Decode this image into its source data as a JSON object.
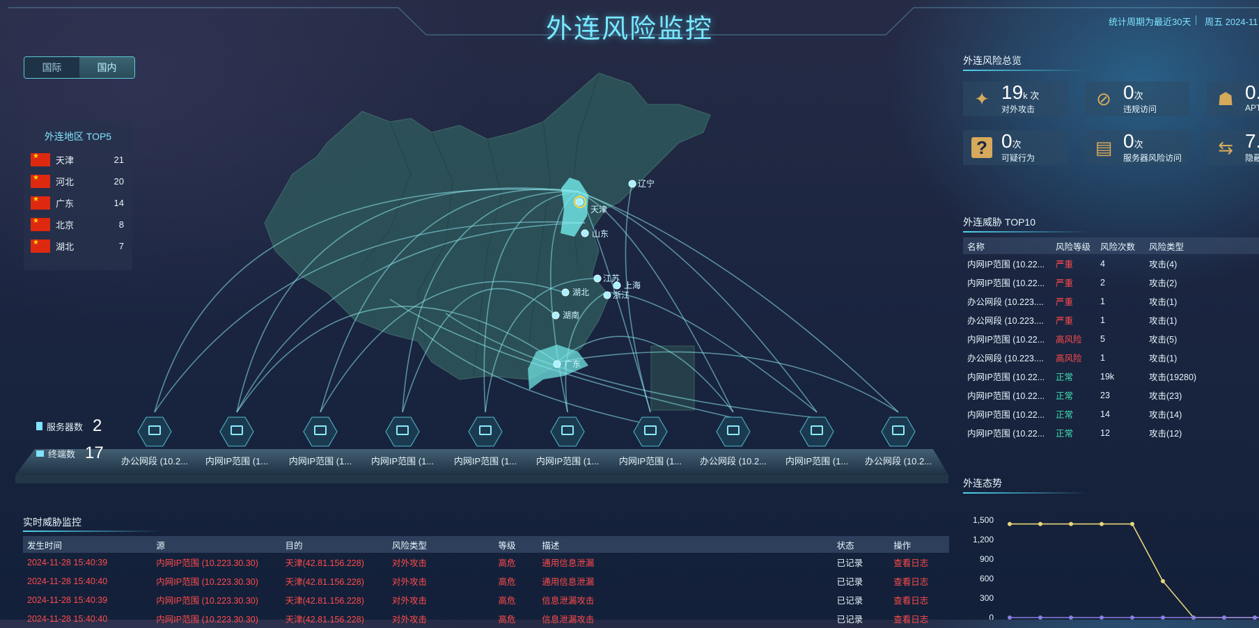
{
  "header": {
    "title": "外连风险监控",
    "period": "统计周期为最近30天",
    "datetime": "周五 2024-11"
  },
  "tabs": [
    {
      "label": "国际",
      "active": false
    },
    {
      "label": "国内",
      "active": true
    }
  ],
  "top5": {
    "title": "外连地区 TOP5",
    "items": [
      {
        "name": "天津",
        "value": "21"
      },
      {
        "name": "河北",
        "value": "20"
      },
      {
        "name": "广东",
        "value": "14"
      },
      {
        "name": "北京",
        "value": "8"
      },
      {
        "name": "湖北",
        "value": "7"
      }
    ]
  },
  "map": {
    "provinces": [
      "辽宁",
      "天津",
      "山东",
      "江苏",
      "上海",
      "浙江",
      "湖北",
      "湖南",
      "广东"
    ]
  },
  "counters": {
    "server_label": "服务器数",
    "server_value": "2",
    "terminal_label": "终端数",
    "terminal_value": "17"
  },
  "nodes": [
    {
      "label": "办公网段 (10.2...",
      "type": "server"
    },
    {
      "label": "内网IP范围 (1...",
      "type": "terminal"
    },
    {
      "label": "内网IP范围 (1...",
      "type": "terminal"
    },
    {
      "label": "内网IP范围 (1...",
      "type": "terminal"
    },
    {
      "label": "内网IP范围 (1...",
      "type": "terminal"
    },
    {
      "label": "内网IP范围 (1...",
      "type": "terminal"
    },
    {
      "label": "内网IP范围 (1...",
      "type": "terminal"
    },
    {
      "label": "办公网段 (10.2...",
      "type": "terminal"
    },
    {
      "label": "内网IP范围 (1...",
      "type": "terminal"
    },
    {
      "label": "办公网段 (10.2...",
      "type": "terminal"
    }
  ],
  "overview": {
    "title": "外连风险总览",
    "cards": [
      {
        "icon": "bomb-icon",
        "num": "19",
        "unit": "k 次",
        "label": "对外攻击"
      },
      {
        "icon": "no-access-icon",
        "num": "0",
        "unit": "次",
        "label": "违规访问"
      },
      {
        "icon": "spy-icon",
        "num": "0.",
        "unit": "",
        "label": "APT"
      },
      {
        "icon": "question-icon",
        "num": "0",
        "unit": "次",
        "label": "可疑行为"
      },
      {
        "icon": "server-alert-icon",
        "num": "0",
        "unit": "次",
        "label": "服务器风险访问"
      },
      {
        "icon": "swap-icon",
        "num": "7.",
        "unit": "",
        "label": "隐蔽"
      }
    ]
  },
  "threats": {
    "title": "外连威胁 TOP10",
    "headers": [
      "名称",
      "风险等级",
      "风险次数",
      "风险类型"
    ],
    "rows": [
      [
        "内网IP范围 (10.22...",
        "严重",
        "4",
        "攻击(4)"
      ],
      [
        "内网IP范围 (10.22...",
        "严重",
        "2",
        "攻击(2)"
      ],
      [
        "办公网段 (10.223....",
        "严重",
        "1",
        "攻击(1)"
      ],
      [
        "办公网段 (10.223....",
        "严重",
        "1",
        "攻击(1)"
      ],
      [
        "内网IP范围 (10.22...",
        "高风险",
        "5",
        "攻击(5)"
      ],
      [
        "办公网段 (10.223....",
        "高风险",
        "1",
        "攻击(1)"
      ],
      [
        "内网IP范围 (10.22...",
        "正常",
        "19k",
        "攻击(19280)"
      ],
      [
        "内网IP范围 (10.22...",
        "正常",
        "23",
        "攻击(23)"
      ],
      [
        "内网IP范围 (10.22...",
        "正常",
        "14",
        "攻击(14)"
      ],
      [
        "内网IP范围 (10.22...",
        "正常",
        "12",
        "攻击(12)"
      ]
    ]
  },
  "trend": {
    "title": "外连态势"
  },
  "chart_data": {
    "type": "line",
    "yticks": [
      "1,500",
      "1,200",
      "900",
      "600",
      "300",
      "0"
    ],
    "ylim": [
      0,
      1500
    ],
    "series": [
      {
        "color": "#e8d77a",
        "values": [
          1440,
          1440,
          1440,
          1440,
          1440,
          560,
          0,
          0,
          0,
          0,
          0
        ]
      },
      {
        "color": "#8a7ee6",
        "values": [
          0,
          0,
          0,
          0,
          0,
          0,
          0,
          0,
          0,
          0,
          0
        ]
      }
    ]
  },
  "realtime": {
    "title": "实时威胁监控",
    "headers": [
      "发生时间",
      "源",
      "目的",
      "风险类型",
      "等级",
      "描述",
      "状态",
      "操作"
    ],
    "rows": [
      [
        "2024-11-28 15:40:39",
        "内网IP范围 (10.223.30.30)",
        "天津(42.81.156.228)",
        "对外攻击",
        "高危",
        "通用信息泄漏",
        "已记录",
        "查看日志"
      ],
      [
        "2024-11-28 15:40:40",
        "内网IP范围 (10.223.30.30)",
        "天津(42.81.156.228)",
        "对外攻击",
        "高危",
        "通用信息泄漏",
        "已记录",
        "查看日志"
      ],
      [
        "2024-11-28 15:40:39",
        "内网IP范围 (10.223.30.30)",
        "天津(42.81.156.228)",
        "对外攻击",
        "高危",
        "信息泄漏攻击",
        "已记录",
        "查看日志"
      ],
      [
        "2024-11-28 15:40:40",
        "内网IP范围 (10.223.30.30)",
        "天津(42.81.156.228)",
        "对外攻击",
        "高危",
        "信息泄漏攻击",
        "已记录",
        "查看日志"
      ]
    ]
  }
}
